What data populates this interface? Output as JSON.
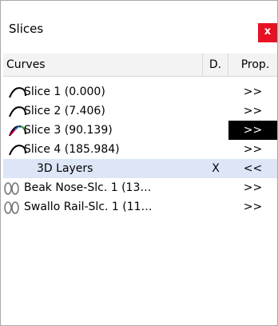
{
  "window": {
    "title": "Slices",
    "close_label": "x"
  },
  "columns": {
    "curves": "Curves",
    "d": "D.",
    "prop": "Prop."
  },
  "rows": [
    {
      "label": "Slice 1 (0.000)",
      "d": "",
      "prop": ">>",
      "icon": "curve-icon"
    },
    {
      "label": "Slice 2 (7.406)",
      "d": "",
      "prop": ">>",
      "icon": "curve-icon"
    },
    {
      "label": "Slice 3 (90.139)",
      "d": "",
      "prop": ">>",
      "icon": "colored-curve-icon",
      "prop_active": true
    },
    {
      "label": "Slice 4 (185.984)",
      "d": "",
      "prop": ">>",
      "icon": "curve-icon"
    },
    {
      "label": "3D Layers",
      "d": "X",
      "prop": "<<",
      "selected": true
    },
    {
      "label": "Beak Nose-Slc. 1 (13…",
      "d": "",
      "prop": ">>",
      "icon": "double-loop-icon"
    },
    {
      "label": "Swallo Rail-Slc. 1 (11…",
      "d": "",
      "prop": ">>",
      "icon": "double-loop-icon"
    }
  ],
  "colors": {
    "close": "#e81123",
    "selected_row": "#dde6f7",
    "active_prop": "#000000"
  }
}
